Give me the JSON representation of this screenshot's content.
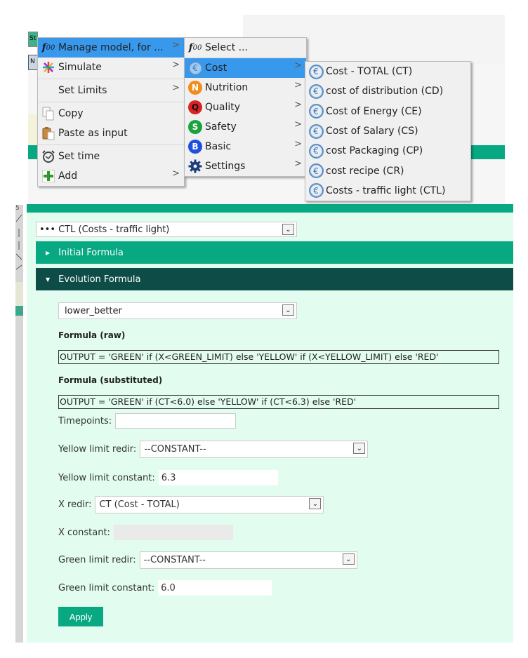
{
  "background": {
    "mini_button_1": "St",
    "mini_button_2": "N",
    "left_strip_tick": "5"
  },
  "context_menu": {
    "items": [
      {
        "label": "Manage model, for ...",
        "icon": "function-icon",
        "has_submenu": true,
        "selected": true
      },
      {
        "label": "Simulate",
        "icon": "simulate-icon",
        "has_submenu": true
      },
      {
        "label": "Set Limits",
        "icon": "",
        "has_submenu": true
      },
      {
        "label": "Copy",
        "icon": "copy-icon",
        "has_submenu": false
      },
      {
        "label": "Paste as input",
        "icon": "paste-icon",
        "has_submenu": false
      },
      {
        "label": "Set time",
        "icon": "alarm-clock-icon",
        "has_submenu": false
      },
      {
        "label": "Add",
        "icon": "plus-icon",
        "has_submenu": true
      }
    ],
    "arrow": ">"
  },
  "model_submenu": {
    "items": [
      {
        "label": "Select ...",
        "icon": "function-icon",
        "has_submenu": false
      },
      {
        "label": "Cost",
        "icon": "euro-icon",
        "badge": "€",
        "color": "#3a6ea8",
        "has_submenu": true,
        "selected": true
      },
      {
        "label": "Nutrition",
        "icon": "nutrition-icon",
        "badge": "N",
        "color": "#f28c1b",
        "has_submenu": true
      },
      {
        "label": "Quality",
        "icon": "quality-icon",
        "badge": "Q",
        "color": "#d92323",
        "has_submenu": true
      },
      {
        "label": "Safety",
        "icon": "safety-icon",
        "badge": "S",
        "color": "#1aa33c",
        "has_submenu": true
      },
      {
        "label": "Basic",
        "icon": "basic-icon",
        "badge": "B",
        "color": "#1f4fe0",
        "has_submenu": true
      },
      {
        "label": "Settings",
        "icon": "gear-icon",
        "color": "#1b3b7a",
        "has_submenu": true
      }
    ]
  },
  "cost_submenu": {
    "items": [
      {
        "label": "Cost - TOTAL (CT)"
      },
      {
        "label": "cost of distribution (CD)"
      },
      {
        "label": "Cost of Energy (CE)"
      },
      {
        "label": "Cost of Salary (CS)"
      },
      {
        "label": "cost Packaging (CP)"
      },
      {
        "label": "cost recipe (CR)"
      },
      {
        "label": "Costs - traffic light (CTL)"
      }
    ],
    "icon_glyph": "€"
  },
  "editor": {
    "variable_select": "••• CTL (Costs - traffic light)",
    "initial_formula_label": "Initial Formula",
    "evolution_formula_label": "Evolution Formula",
    "mode_select": "lower_better",
    "formula_raw_label": "Formula (raw)",
    "formula_raw": "OUTPUT = 'GREEN' if (X<GREEN_LIMIT) else 'YELLOW' if (X<YELLOW_LIMIT) else 'RED'",
    "formula_substituted_label": "Formula (substituted)",
    "formula_substituted": "OUTPUT = 'GREEN' if (CT<6.0) else 'YELLOW' if (CT<6.3) else 'RED'",
    "timepoints_label": "Timepoints:",
    "timepoints_value": "",
    "yellow_limit_redir_label": "Yellow limit redir:",
    "yellow_limit_redir_value": "--CONSTANT--",
    "yellow_limit_constant_label": "Yellow limit constant:",
    "yellow_limit_constant_value": "6.3",
    "x_redir_label": "X redir:",
    "x_redir_value": "CT (Cost - TOTAL)",
    "x_constant_label": "X constant:",
    "x_constant_value": "",
    "green_limit_redir_label": "Green limit redir:",
    "green_limit_redir_value": "--CONSTANT--",
    "green_limit_constant_label": "Green limit constant:",
    "green_limit_constant_value": "6.0",
    "apply_label": "Apply",
    "dropdown_arrow": "⌄"
  },
  "colors": {
    "accent_green": "#07a882",
    "dark_teal": "#0e4c48",
    "panel_bg": "#e2fcef",
    "menu_highlight": "#3898ec"
  }
}
